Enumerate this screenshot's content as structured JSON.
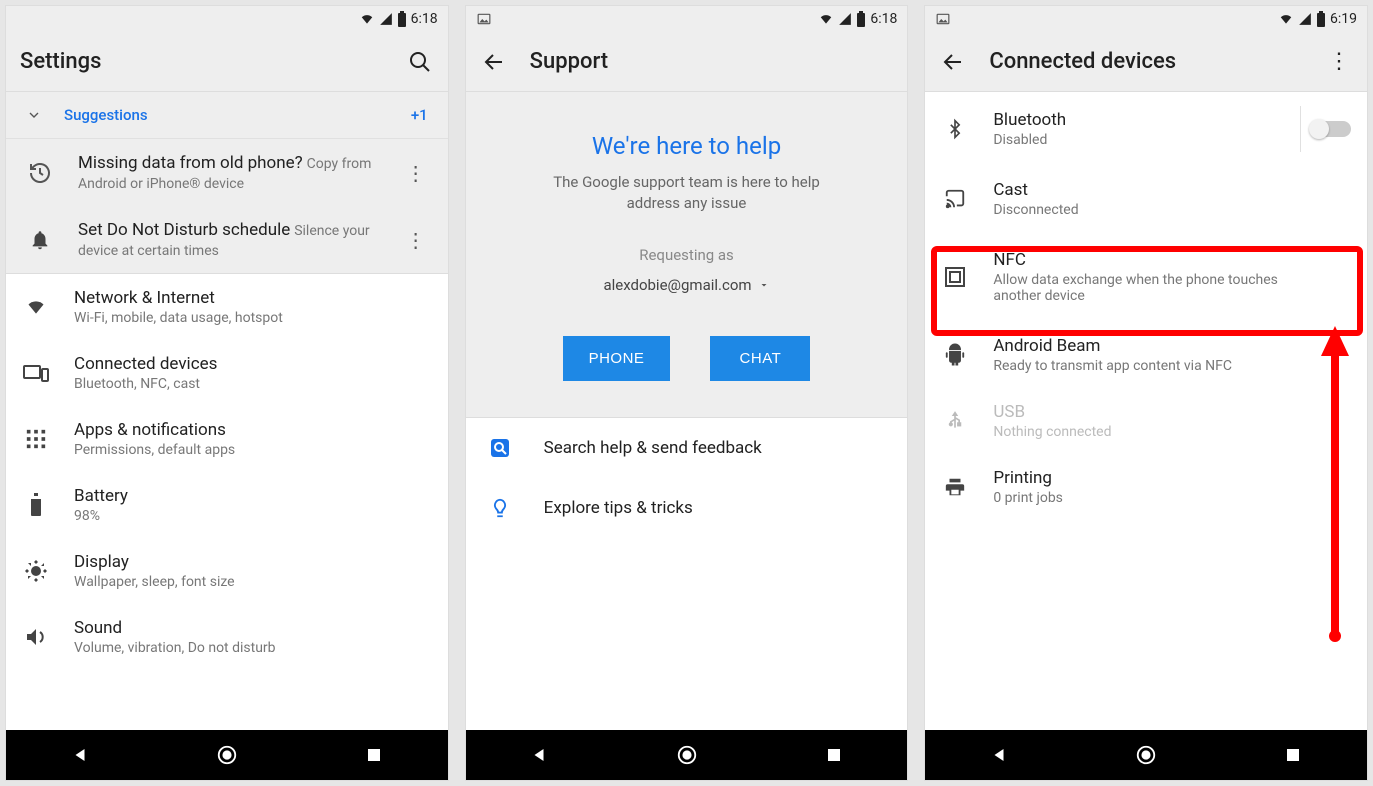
{
  "screen1": {
    "status_time": "6:18",
    "title": "Settings",
    "suggestions_label": "Suggestions",
    "suggestions_count": "+1",
    "sugg1_title": "Missing data from old phone?",
    "sugg1_sub": "Copy from Android or iPhone® device",
    "sugg2_title": "Set Do Not Disturb schedule",
    "sugg2_sub": "Silence your device at certain times",
    "items": {
      "network": {
        "title": "Network & Internet",
        "sub": "Wi-Fi, mobile, data usage, hotspot"
      },
      "connected": {
        "title": "Connected devices",
        "sub": "Bluetooth, NFC, cast"
      },
      "apps": {
        "title": "Apps & notifications",
        "sub": "Permissions, default apps"
      },
      "battery": {
        "title": "Battery",
        "sub": "98%"
      },
      "display": {
        "title": "Display",
        "sub": "Wallpaper, sleep, font size"
      },
      "sound": {
        "title": "Sound",
        "sub": "Volume, vibration, Do not disturb"
      }
    }
  },
  "screen2": {
    "status_time": "6:18",
    "title": "Support",
    "headline": "We're here to help",
    "subline": "The Google support team is here to help address any issue",
    "requesting_label": "Requesting as",
    "email": "alexdobie@gmail.com",
    "phone_btn": "PHONE",
    "chat_btn": "CHAT",
    "search_help": "Search help & send feedback",
    "explore": "Explore tips & tricks"
  },
  "screen3": {
    "status_time": "6:19",
    "title": "Connected devices",
    "bluetooth": {
      "title": "Bluetooth",
      "sub": "Disabled"
    },
    "cast": {
      "title": "Cast",
      "sub": "Disconnected"
    },
    "nfc": {
      "title": "NFC",
      "sub": "Allow data exchange when the phone touches another device"
    },
    "beam": {
      "title": "Android Beam",
      "sub": "Ready to transmit app content via NFC"
    },
    "usb": {
      "title": "USB",
      "sub": "Nothing connected"
    },
    "printing": {
      "title": "Printing",
      "sub": "0 print jobs"
    }
  }
}
